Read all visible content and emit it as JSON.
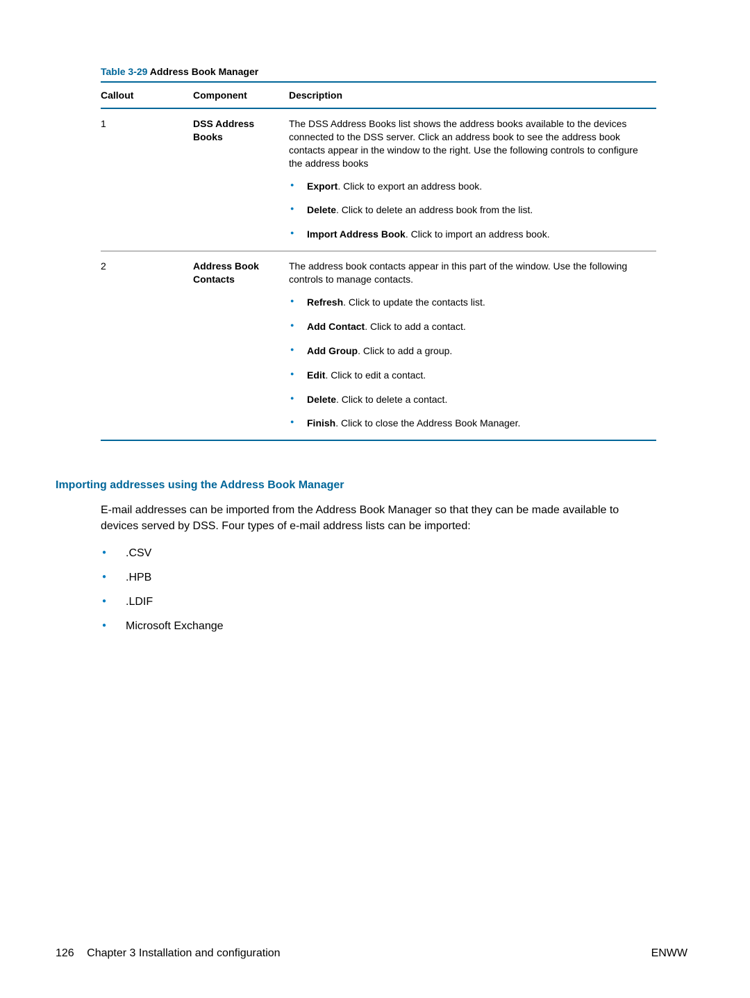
{
  "table": {
    "caption_label": "Table 3-29",
    "caption_title": "  Address Book Manager",
    "headers": {
      "callout": "Callout",
      "component": "Component",
      "description": "Description"
    },
    "rows": [
      {
        "callout": "1",
        "component": "DSS Address Books",
        "intro": "The DSS Address Books list shows the address books available to the devices connected to the DSS server. Click an address book to see the address book contacts appear in the window to the right. Use the following controls to configure the address books",
        "items": [
          {
            "bold": "Export",
            "rest": ". Click to export an address book."
          },
          {
            "bold": "Delete",
            "rest": ". Click to delete an address book from the list."
          },
          {
            "bold": "Import Address Book",
            "rest": ". Click to import an address book."
          }
        ]
      },
      {
        "callout": "2",
        "component": "Address Book Contacts",
        "intro": "The address book contacts appear in this part of the window. Use the following controls to manage contacts.",
        "items": [
          {
            "bold": "Refresh",
            "rest": ". Click to update the contacts list."
          },
          {
            "bold": "Add Contact",
            "rest": ". Click to add a contact."
          },
          {
            "bold": "Add Group",
            "rest": ". Click to add a group."
          },
          {
            "bold": "Edit",
            "rest": ". Click to edit a contact."
          },
          {
            "bold": "Delete",
            "rest": ". Click to delete a contact."
          },
          {
            "bold": "Finish",
            "rest": ". Click to close the Address Book Manager."
          }
        ]
      }
    ]
  },
  "section": {
    "heading": "Importing addresses using the Address Book Manager",
    "para": "E-mail addresses can be imported from the Address Book Manager so that they can be made available to devices served by DSS. Four types of e-mail address lists can be imported:",
    "items": [
      ".CSV",
      ".HPB",
      ".LDIF",
      "Microsoft Exchange"
    ]
  },
  "footer": {
    "page_num": "126",
    "chapter": "Chapter 3   Installation and configuration",
    "right": "ENWW"
  }
}
